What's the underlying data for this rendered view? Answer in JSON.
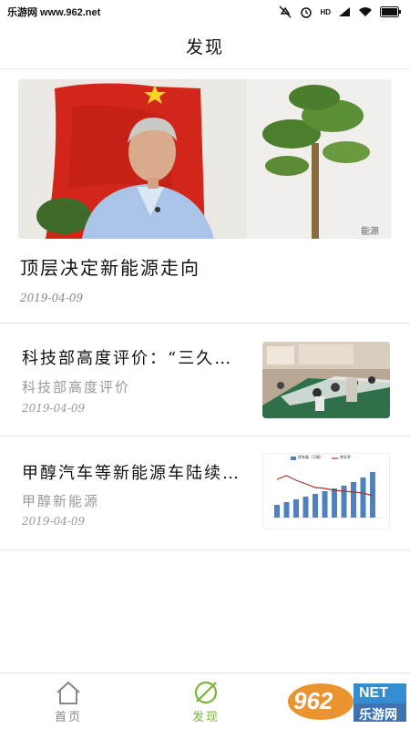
{
  "status_bar": {
    "carrier": "乐游网 www.962.net",
    "network_label": "HD"
  },
  "header": {
    "title": "发现"
  },
  "hero": {
    "title": "顶层决定新能源走向",
    "date": "2019-04-09",
    "photo_watermark": "能源"
  },
  "articles": [
    {
      "title": "科技部高度评价：“三久…",
      "source": "科技部高度评价",
      "date": "2019-04-09"
    },
    {
      "title": "甲醇汽车等新能源车陆续…",
      "source": "甲醇新能源",
      "date": "2019-04-09"
    }
  ],
  "chart_thumbnail": {
    "legend": [
      "保有量（万辆）",
      "增长率"
    ]
  },
  "tabbar": {
    "tabs": [
      {
        "label": "首页"
      },
      {
        "label": "发现"
      }
    ],
    "active_color": "#7ab43b",
    "inactive_color": "#888888"
  },
  "watermark": {
    "number": "962",
    "suffix": "NET",
    "name": "乐游网"
  }
}
